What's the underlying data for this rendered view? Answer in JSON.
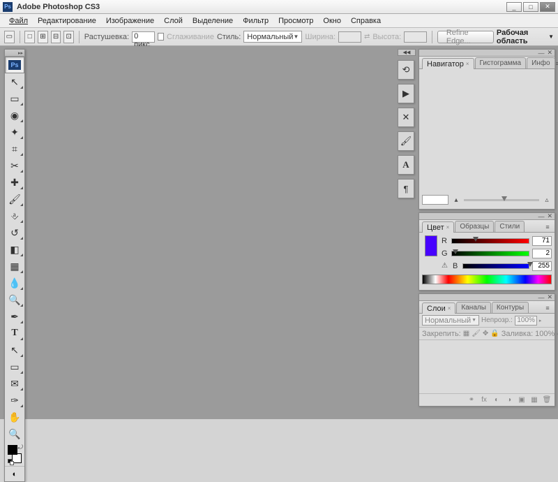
{
  "window": {
    "title": "Adobe Photoshop CS3",
    "app_icon": "Ps"
  },
  "menu": {
    "file": "Файл",
    "edit": "Редактирование",
    "image": "Изображение",
    "layer": "Слой",
    "select": "Выделение",
    "filter": "Фильтр",
    "view": "Просмотр",
    "window": "Окно",
    "help": "Справка"
  },
  "optbar": {
    "feather_label": "Растушевка:",
    "feather_value": "0 пикс.",
    "antialias_label": "Сглаживание",
    "style_label": "Стиль:",
    "style_value": "Нормальный",
    "width_label": "Ширина:",
    "height_label": "Высота:",
    "refine_btn": "Refine Edge...",
    "workspace_label": "Рабочая область"
  },
  "panels": {
    "navigator": {
      "tab": "Навигатор",
      "histogram_tab": "Гистограмма",
      "info_tab": "Инфо"
    },
    "color": {
      "tab": "Цвет",
      "swatches_tab": "Образцы",
      "styles_tab": "Стили",
      "r_label": "R",
      "g_label": "G",
      "b_label": "B",
      "r_value": "71",
      "g_value": "2",
      "b_value": "255"
    },
    "layers": {
      "tab": "Слои",
      "channels_tab": "Каналы",
      "paths_tab": "Контуры",
      "blend_mode": "Нормальный",
      "opacity_label": "Непрозр.:",
      "opacity_value": "100%",
      "lock_label": "Закрепить:",
      "fill_label": "Заливка:",
      "fill_value": "100%"
    }
  },
  "tools": {
    "ps": "Ps",
    "move": "↖",
    "marquee": "▭",
    "lasso": "◉",
    "wand": "✦",
    "crop": "⌗",
    "slice": "✂",
    "heal": "✚",
    "brush": "🖌",
    "stamp": "⎀",
    "history": "↺",
    "eraser": "◧",
    "gradient": "▦",
    "blur": "💧",
    "dodge": "🔍",
    "pen": "✒",
    "type": "T",
    "path": "↖",
    "shape": "▭",
    "notes": "✉",
    "eyedrop": "✑",
    "hand": "✋",
    "zoom": "🔍",
    "quickmask": "◐"
  },
  "dock": {
    "history": "⟲",
    "actions": "▶",
    "tools": "✕",
    "brushes": "🖌",
    "char": "A",
    "para": "¶"
  }
}
